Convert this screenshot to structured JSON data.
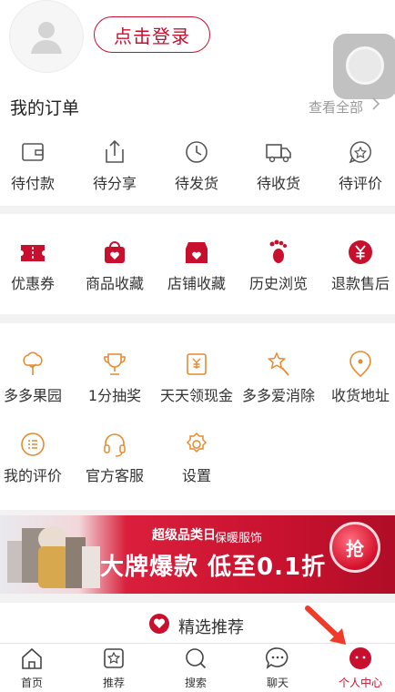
{
  "header": {
    "login_label": "点击登录"
  },
  "orders": {
    "title": "我的订单",
    "view_all": "查看全部",
    "items": [
      {
        "label": "待付款",
        "icon": "wallet-icon"
      },
      {
        "label": "待分享",
        "icon": "share-icon"
      },
      {
        "label": "待发货",
        "icon": "clock-icon"
      },
      {
        "label": "待收货",
        "icon": "truck-icon"
      },
      {
        "label": "待评价",
        "icon": "star-bubble-icon"
      }
    ]
  },
  "favorites": {
    "items": [
      {
        "label": "优惠券",
        "icon": "coupon-icon"
      },
      {
        "label": "商品收藏",
        "icon": "bag-heart-icon"
      },
      {
        "label": "店铺收藏",
        "icon": "store-heart-icon"
      },
      {
        "label": "历史浏览",
        "icon": "footprint-icon"
      },
      {
        "label": "退款售后",
        "icon": "yuan-icon"
      }
    ]
  },
  "services": {
    "items": [
      {
        "label": "多多果园",
        "icon": "tree-icon"
      },
      {
        "label": "1分抽奖",
        "icon": "trophy-icon"
      },
      {
        "label": "天天领现金",
        "icon": "cash-envelope-icon"
      },
      {
        "label": "多多爱消除",
        "icon": "magic-star-icon"
      },
      {
        "label": "收货地址",
        "icon": "location-icon"
      },
      {
        "label": "我的评价",
        "icon": "comment-icon"
      },
      {
        "label": "官方客服",
        "icon": "headset-icon"
      },
      {
        "label": "设置",
        "icon": "settings-icon"
      }
    ]
  },
  "banner": {
    "logo": "超级品类日",
    "tag": "保暖服饰",
    "headline": "大牌爆款  低至0.1折",
    "grab": "抢"
  },
  "recommend": {
    "label": "精选推荐"
  },
  "nav": {
    "items": [
      {
        "label": "首页",
        "icon": "home-icon"
      },
      {
        "label": "推荐",
        "icon": "recommend-icon"
      },
      {
        "label": "搜索",
        "icon": "search-icon"
      },
      {
        "label": "聊天",
        "icon": "chat-icon"
      },
      {
        "label": "个人中心",
        "icon": "profile-icon"
      }
    ],
    "active_color": "#c8102e"
  }
}
